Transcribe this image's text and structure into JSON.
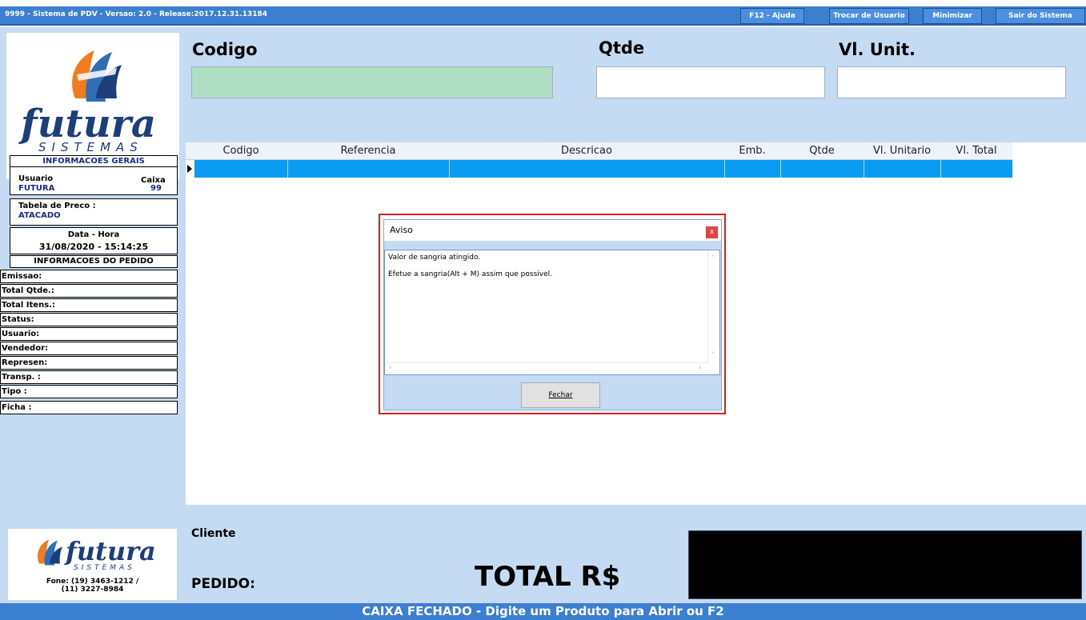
{
  "window": {
    "title": "9999 - Sistema de PDV - Versao: 2.0 - Release:2017.12.31.13184",
    "buttons": {
      "help": "F12 - Ajuda",
      "switch_user": "Trocar de Usuario",
      "minimize": "Minimizar",
      "exit": "Sair do Sistema"
    }
  },
  "logo": {
    "brand": "futura",
    "sub": "SISTEMAS"
  },
  "info": {
    "title": "INFORMACOES GERAIS",
    "usuario_label": "Usuario",
    "usuario_value": "FUTURA",
    "caixa_label": "Caixa",
    "caixa_value": "99",
    "tabela_label": "Tabela de Preco :",
    "tabela_value": "ATACADO",
    "datahora_label": "Data - Hora",
    "datahora_value": "31/08/2020 - 15:14:25"
  },
  "pedido_info": {
    "title": "INFORMACOES DO PEDIDO",
    "rows": [
      "Emissao:",
      "Total Qtde.:",
      "Total Itens.:",
      "Status:",
      "Usuario:",
      "Vendedor:",
      "Represen:",
      "Transp. :",
      "Tipo :",
      "Ficha :"
    ]
  },
  "contact": {
    "phone": "Fone: (19) 3463-1212 /",
    "phone2": "(11) 3227-8984"
  },
  "header": {
    "codigo": "Codigo",
    "qtde": "Qtde",
    "vl_unit": "Vl. Unit."
  },
  "grid": {
    "columns": [
      "Codigo",
      "Referencia",
      "Descricao",
      "Emb.",
      "Qtde",
      "Vl. Unitario",
      "Vl. Total"
    ]
  },
  "footer": {
    "cliente": "Cliente",
    "pedido": "PEDIDO:",
    "total": "TOTAL R$"
  },
  "status": "CAIXA FECHADO - Digite um Produto para Abrir ou F2",
  "dialog": {
    "title": "Aviso",
    "close": "x",
    "line1": "Valor de sangria atingido.",
    "line2": "Efetue a sangria(Alt + M) assim que possivel.",
    "button": "Fechar"
  },
  "colors": {
    "titlebar": "#3a7fd0",
    "panel": "#c5daf3",
    "codigo_input": "#b0dec4",
    "selected_row": "#0a9bf3",
    "dialog_highlight": "#e02020",
    "total_display": "#000000"
  }
}
